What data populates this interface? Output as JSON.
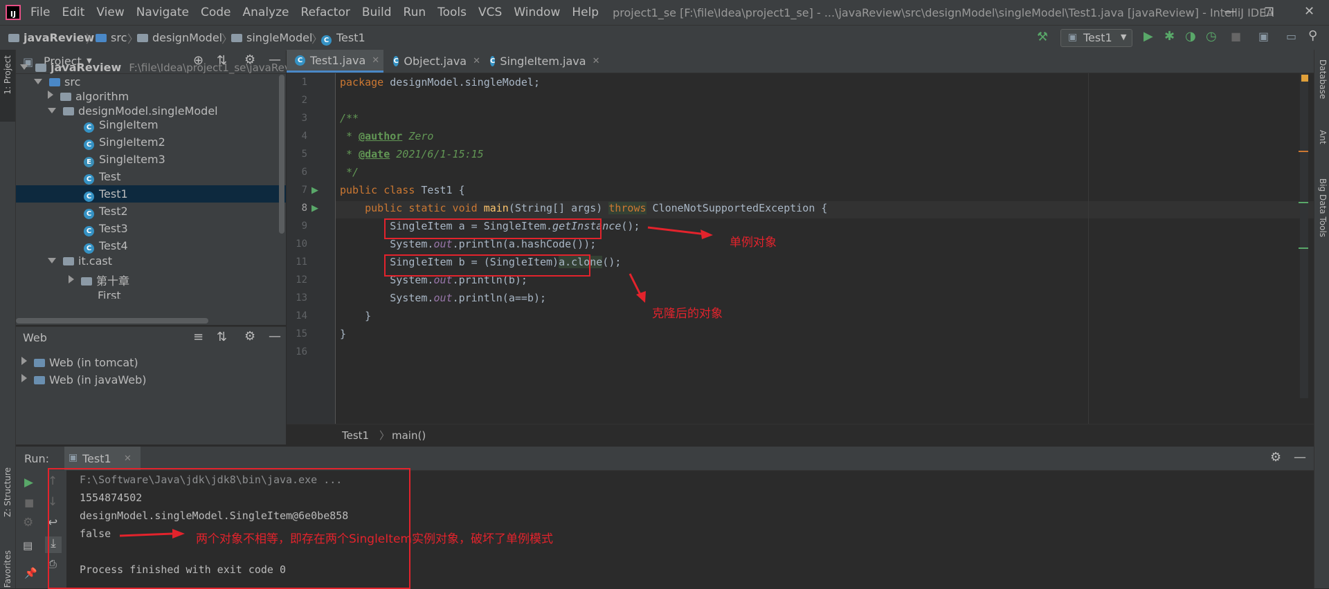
{
  "menu": [
    "File",
    "Edit",
    "View",
    "Navigate",
    "Code",
    "Analyze",
    "Refactor",
    "Build",
    "Run",
    "Tools",
    "VCS",
    "Window",
    "Help"
  ],
  "window_title": "project1_se [F:\\file\\Idea\\project1_se] - ...\\javaReview\\src\\designModel\\singleModel\\Test1.java [javaReview] - IntelliJ IDEA",
  "breadcrumb": [
    "javaReview",
    "src",
    "designModel",
    "singleModel",
    "Test1"
  ],
  "run_config": "Test1",
  "left_strip": {
    "project": "1: Project",
    "structure": "Z: Structure",
    "favorites": "Favorites"
  },
  "right_strip": [
    "Database",
    "Ant",
    "Big Data Tools"
  ],
  "project_panel": {
    "title": "Project",
    "root_name": "javaReview",
    "root_path": "F:\\file\\Idea\\project1_se\\javaRevie",
    "nodes": [
      "src",
      "algorithm",
      "designModel.singleModel",
      "SingleItem",
      "SingleItem2",
      "SingleItem3",
      "Test",
      "Test1",
      "Test2",
      "Test3",
      "Test4",
      "it.cast",
      "第十章",
      "First"
    ]
  },
  "web_panel": {
    "title": "Web",
    "items": [
      "Web (in tomcat)",
      "Web (in javaWeb)"
    ]
  },
  "tabs": [
    "Test1.java",
    "Object.java",
    "SingleItem.java"
  ],
  "editor_crumb": [
    "Test1",
    "main()"
  ],
  "code_lines": [
    "1",
    "2",
    "3",
    "4",
    "5",
    "6",
    "7",
    "8",
    "9",
    "10",
    "11",
    "12",
    "13",
    "14",
    "15",
    "16"
  ],
  "code": {
    "l1a": "package",
    "l1b": " designModel.singleModel;",
    "l3": "/**",
    "l4a": " * ",
    "l4b": "@author",
    "l4c": " Zero",
    "l5a": " * ",
    "l5b": "@date",
    "l5c": " 2021/6/1-15:15",
    "l6": " */",
    "l7a": "public class",
    "l7b": " Test1 {",
    "l8a": "    public static void ",
    "l8b": "main",
    "l8c": "(String[] args) ",
    "l8d": "throws",
    "l8e": " CloneNotSupportedException {",
    "l9a": "        SingleItem a = SingleItem.",
    "l9b": "getInstance",
    "l9c": "();",
    "l10a": "        System.",
    "l10b": "out",
    "l10c": ".println(a.hashCode());",
    "l11a": "        SingleItem b = (SingleItem)",
    "l11b": "a.clone",
    "l11c": "();",
    "l12a": "        System.",
    "l12b": "out",
    "l12c": ".println(b);",
    "l13a": "        System.",
    "l13b": "out",
    "l13c": ".println(a==b);",
    "l14": "    }",
    "l15": "}"
  },
  "annotations": {
    "singleton": "单例对象",
    "cloned": "克隆后的对象",
    "result": "两个对象不相等，即存在两个SingleItem实例对象，破坏了单例模式"
  },
  "run_panel": {
    "label": "Run:",
    "tab": "Test1",
    "console": [
      "F:\\Software\\Java\\jdk\\jdk8\\bin\\java.exe ...",
      "1554874502",
      "designModel.singleModel.SingleItem@6e0be858",
      "false",
      "",
      "Process finished with exit code 0"
    ]
  }
}
